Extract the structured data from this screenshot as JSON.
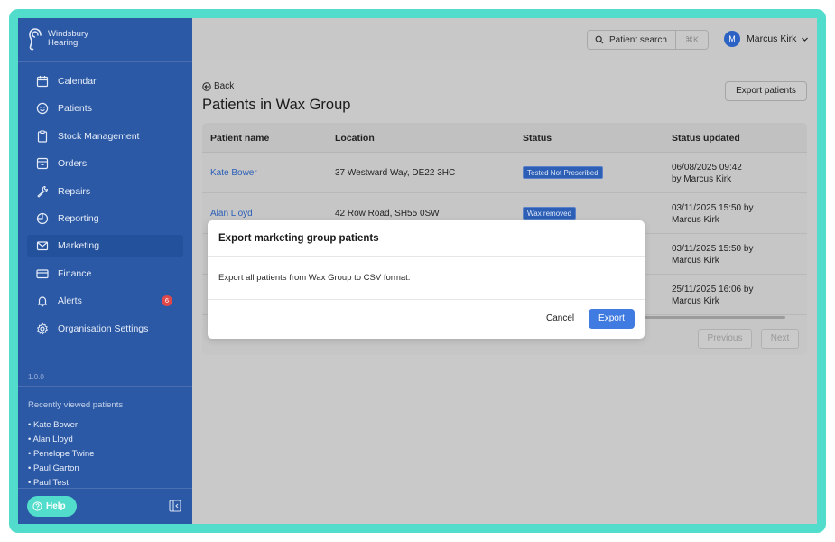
{
  "brand": {
    "line1": "Windsbury",
    "line2": "Hearing"
  },
  "colors": {
    "accent": "#52dccb",
    "sidebar": "#2c59a5",
    "primary_button": "#3f7be0",
    "badge": "#e0484a"
  },
  "nav": [
    {
      "label": "Calendar",
      "icon": "calendar-icon"
    },
    {
      "label": "Patients",
      "icon": "smiley-icon"
    },
    {
      "label": "Stock Management",
      "icon": "clipboard-icon"
    },
    {
      "label": "Orders",
      "icon": "inbox-icon"
    },
    {
      "label": "Repairs",
      "icon": "wrench-icon"
    },
    {
      "label": "Reporting",
      "icon": "pie-chart-icon"
    },
    {
      "label": "Marketing",
      "icon": "envelope-icon",
      "active": true
    },
    {
      "label": "Finance",
      "icon": "credit-card-icon"
    },
    {
      "label": "Alerts",
      "icon": "bell-icon",
      "badge": "6"
    },
    {
      "label": "Organisation Settings",
      "icon": "gear-icon"
    }
  ],
  "version": "1.0.0",
  "recent": {
    "title": "Recently viewed patients",
    "items": [
      "• Kate Bower",
      "• Alan Lloyd",
      "• Penelope Twine",
      "• Paul Garton",
      "• Paul Test"
    ]
  },
  "help_label": "Help",
  "topbar": {
    "search_label": "Patient search",
    "shortcut": "⌘K",
    "user_initial": "M",
    "user_name": "Marcus Kirk"
  },
  "page": {
    "back_label": "Back",
    "title": "Patients in Wax Group",
    "export_label": "Export patients"
  },
  "table": {
    "headers": [
      "Patient name",
      "Location",
      "Status",
      "Status updated"
    ],
    "rows": [
      {
        "name": "Kate Bower",
        "location": "37 Westward Way, DE22 3HC",
        "status": "Tested Not Prescribed",
        "updated_line1": "06/08/2025 09:42",
        "updated_line2": "by Marcus Kirk"
      },
      {
        "name": "Alan Lloyd",
        "location": "42 Row Road, SH55 0SW",
        "status": "Wax removed",
        "updated_line1": "03/11/2025 15:50 by",
        "updated_line2": "Marcus Kirk"
      },
      {
        "name": "",
        "location": "",
        "status": "",
        "updated_line1": "03/11/2025 15:50 by",
        "updated_line2": "Marcus Kirk"
      },
      {
        "name": "",
        "location": "",
        "status": "",
        "updated_line1": "25/11/2025 16:06 by",
        "updated_line2": "Marcus Kirk"
      }
    ],
    "previous_label": "Previous",
    "next_label": "Next"
  },
  "modal": {
    "title": "Export marketing group patients",
    "body": "Export all patients from Wax Group to CSV format.",
    "cancel_label": "Cancel",
    "export_label": "Export"
  }
}
